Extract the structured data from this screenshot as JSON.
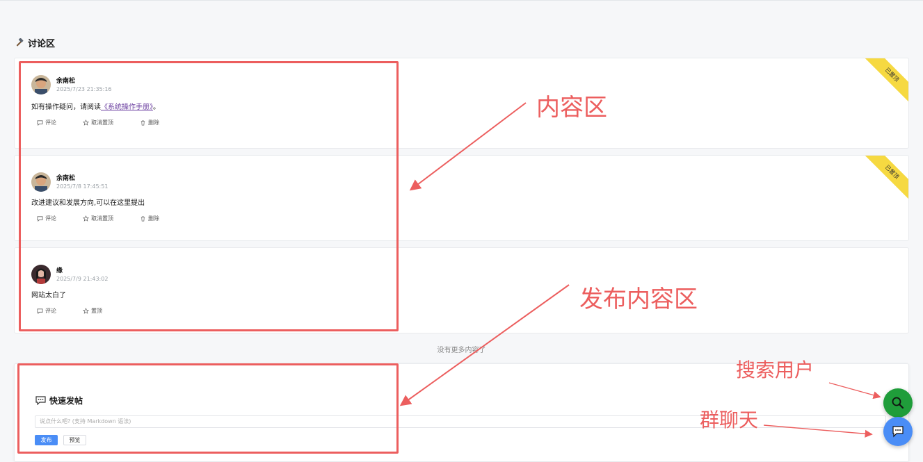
{
  "section": {
    "title": "讨论区",
    "icon": "hammer-icon"
  },
  "posts": [
    {
      "username": "余南松",
      "date": "2025/7/23 21:35:16",
      "content_prefix": "如有操作疑问，请阅读",
      "link_text": "《系统操作手册》",
      "content_suffix": "。",
      "badge": "已置顶",
      "actions": [
        "评论",
        "取消置顶",
        "删除"
      ]
    },
    {
      "username": "余南松",
      "date": "2025/7/8 17:45:51",
      "content": "改进建议和发展方向,可以在这里提出",
      "badge": "已置顶",
      "actions": [
        "评论",
        "取消置顶",
        "删除"
      ]
    },
    {
      "username": "缘",
      "date": "2025/7/9 21:43:02",
      "content": "网站太白了",
      "actions": [
        "评论",
        "置顶"
      ]
    }
  ],
  "no_more_text": "没有更多内容了",
  "quick_post": {
    "title": "快速发帖",
    "placeholder": "说点什么吧? (支持 Markdown 语法)",
    "publish_label": "发布",
    "preview_label": "预览"
  },
  "annotations": {
    "content_area": "内容区",
    "publish_area": "发布内容区",
    "search_users": "搜索用户",
    "group_chat": "群聊天",
    "color": "#ec5e5e"
  },
  "fab": {
    "search_icon": "search-icon",
    "chat_icon": "chat-icon",
    "search_color": "#1f9d3a",
    "chat_color": "#4a8df6"
  }
}
